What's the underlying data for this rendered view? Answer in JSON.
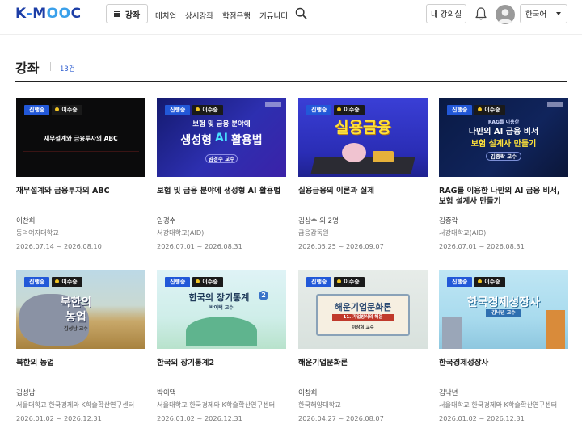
{
  "header": {
    "logo": {
      "left": "K",
      "dash": "-",
      "mid": "M",
      "oo": "OO",
      "end": "C"
    },
    "menu_label": "강좌",
    "nav": [
      "매치업",
      "상시강좌",
      "학점은행",
      "커뮤니티"
    ],
    "my_classroom": "내 강의실",
    "language": "한국어"
  },
  "section": {
    "title": "강좌",
    "count": "13건"
  },
  "badges": {
    "live": "진행중",
    "cert": "이수증"
  },
  "courses": [
    {
      "thumb_text": [
        "재무설계와 금융투자의 ABC"
      ],
      "title": "재무설계와 금융투자의 ABC",
      "professor": "이찬희",
      "org": "동덕여자대학교",
      "period": "2026.07.14 ~ 2026.08.10"
    },
    {
      "thumb_text": [
        "보험 및 금융 분야에",
        "생성형",
        "AI",
        "활용법",
        "임경수 교수"
      ],
      "title": "보험 및 금융 분야에 생성형 AI 활용법",
      "professor": "임경수",
      "org": "서강대학교(AID)",
      "period": "2026.07.01 ~ 2026.08.31"
    },
    {
      "thumb_text": [
        "실용금융"
      ],
      "title": "실용금융의 이론과 실제",
      "professor": "김상수 외 2명",
      "org": "금융감독원",
      "period": "2026.05.25 ~ 2026.09.07"
    },
    {
      "thumb_text": [
        "RAG를 이용한",
        "나만의 AI 금융 비서",
        "보험 설계사 만들기",
        "김종락 교수"
      ],
      "title": "RAG를 이용한 나만의 AI 금융 비서, 보험 설계사 만들기",
      "professor": "김종락",
      "org": "서강대학교(AID)",
      "period": "2026.07.01 ~ 2026.08.31"
    },
    {
      "thumb_text": [
        "북한의",
        "농업",
        "김성남 교수"
      ],
      "title": "북한의 농업",
      "professor": "김성남",
      "org": "서울대학교 한국경제와 K학술확산연구센터",
      "period": "2026.01.02 ~ 2026.12.31"
    },
    {
      "thumb_text": [
        "한국의 장기통계",
        "2",
        "박이택 교수"
      ],
      "title": "한국의 장기통계2",
      "professor": "박이택",
      "org": "서울대학교 한국경제와 K학술확산연구센터",
      "period": "2026.01.02 ~ 2026.12.31"
    },
    {
      "thumb_text": [
        "해운기업문화론",
        "11. 가업방식의 해운",
        "이창희 교수"
      ],
      "title": "해운기업문화론",
      "professor": "이창희",
      "org": "한국해양대학교",
      "period": "2026.04.27 ~ 2026.08.07"
    },
    {
      "thumb_text": [
        "한국경제성장사",
        "김낙년 교수"
      ],
      "title": "한국경제성장사",
      "professor": "김낙년",
      "org": "서울대학교 한국경제와 K학술확산연구센터",
      "period": "2026.01.02 ~ 2026.12.31"
    }
  ],
  "colors": {
    "accent": "#2258d8",
    "logo": "#1d3ea6",
    "count": "#2f5fd0"
  }
}
